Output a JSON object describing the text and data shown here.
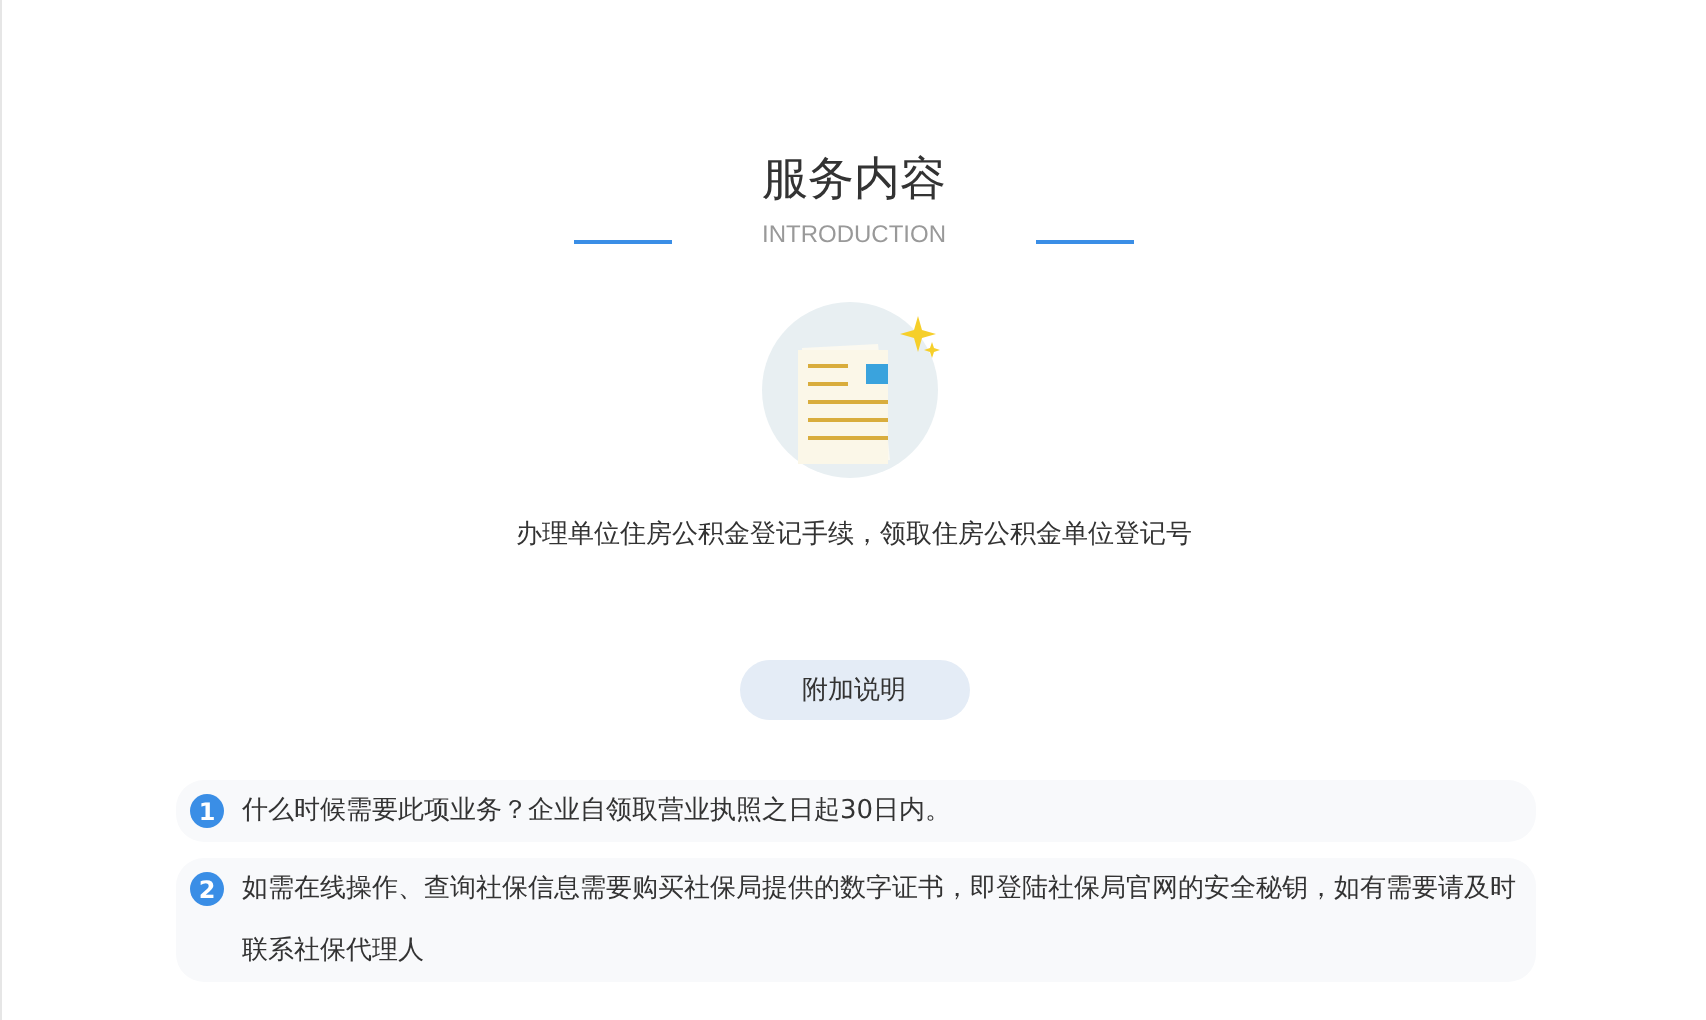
{
  "header": {
    "title": "服务内容",
    "subtitle": "INTRODUCTION"
  },
  "description": "办理单位住房公积金登记手续，领取住房公积金单位登记号",
  "extra_button": "附加说明",
  "notes": [
    {
      "number": "1",
      "text": "什么时候需要此项业务？企业自领取营业执照之日起30日内。"
    },
    {
      "number": "2",
      "text": "如需在线操作、查询社保信息需要购买社保局提供的数字证书，即登陆社保局官网的安全秘钥，如有需要请及时联系社保代理人"
    }
  ]
}
